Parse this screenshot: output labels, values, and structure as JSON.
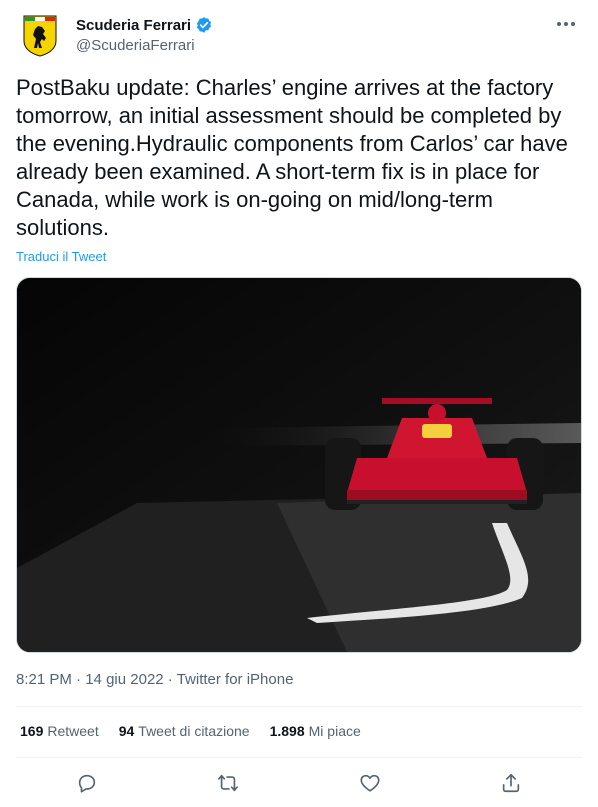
{
  "author": {
    "display_name": "Scuderia Ferrari",
    "handle": "@ScuderiaFerrari",
    "verified": true,
    "avatar_icon": "ferrari-shield-logo",
    "avatar_colors": {
      "shield": "#f5d400",
      "horse": "#111111",
      "stripe_green": "#1b9b3a",
      "stripe_red": "#e2231a"
    }
  },
  "tweet": {
    "text": "PostBaku update: Charles’ engine arrives at the factory tomorrow, an initial assessment should be completed by the evening.Hydraulic components from Carlos’ car have already been examined. A short-term fix is in place for Canada, while work is on-going on mid/long-term solutions.",
    "translate_label": "Traduci il Tweet"
  },
  "media": {
    "alt": "",
    "colors": {
      "background": "#0d0d0d",
      "car": "#c8102e",
      "track": "#3a3a3a",
      "line": "#e8e8e8"
    }
  },
  "meta": {
    "time": "8:21 PM",
    "separator": "·",
    "date": "14 giu 2022",
    "source": "Twitter for iPhone"
  },
  "stats": {
    "retweets_count": "169",
    "retweets_label": "Retweet",
    "quotes_count": "94",
    "quotes_label": "Tweet di citazione",
    "likes_count": "1.898",
    "likes_label": "Mi piace"
  },
  "actions": [
    "reply-icon",
    "retweet-icon",
    "like-icon",
    "share-icon"
  ],
  "colors": {
    "accent": "#1d9bf0",
    "text": "#0f1419",
    "secondary": "#536471",
    "border": "#eff3f4"
  }
}
